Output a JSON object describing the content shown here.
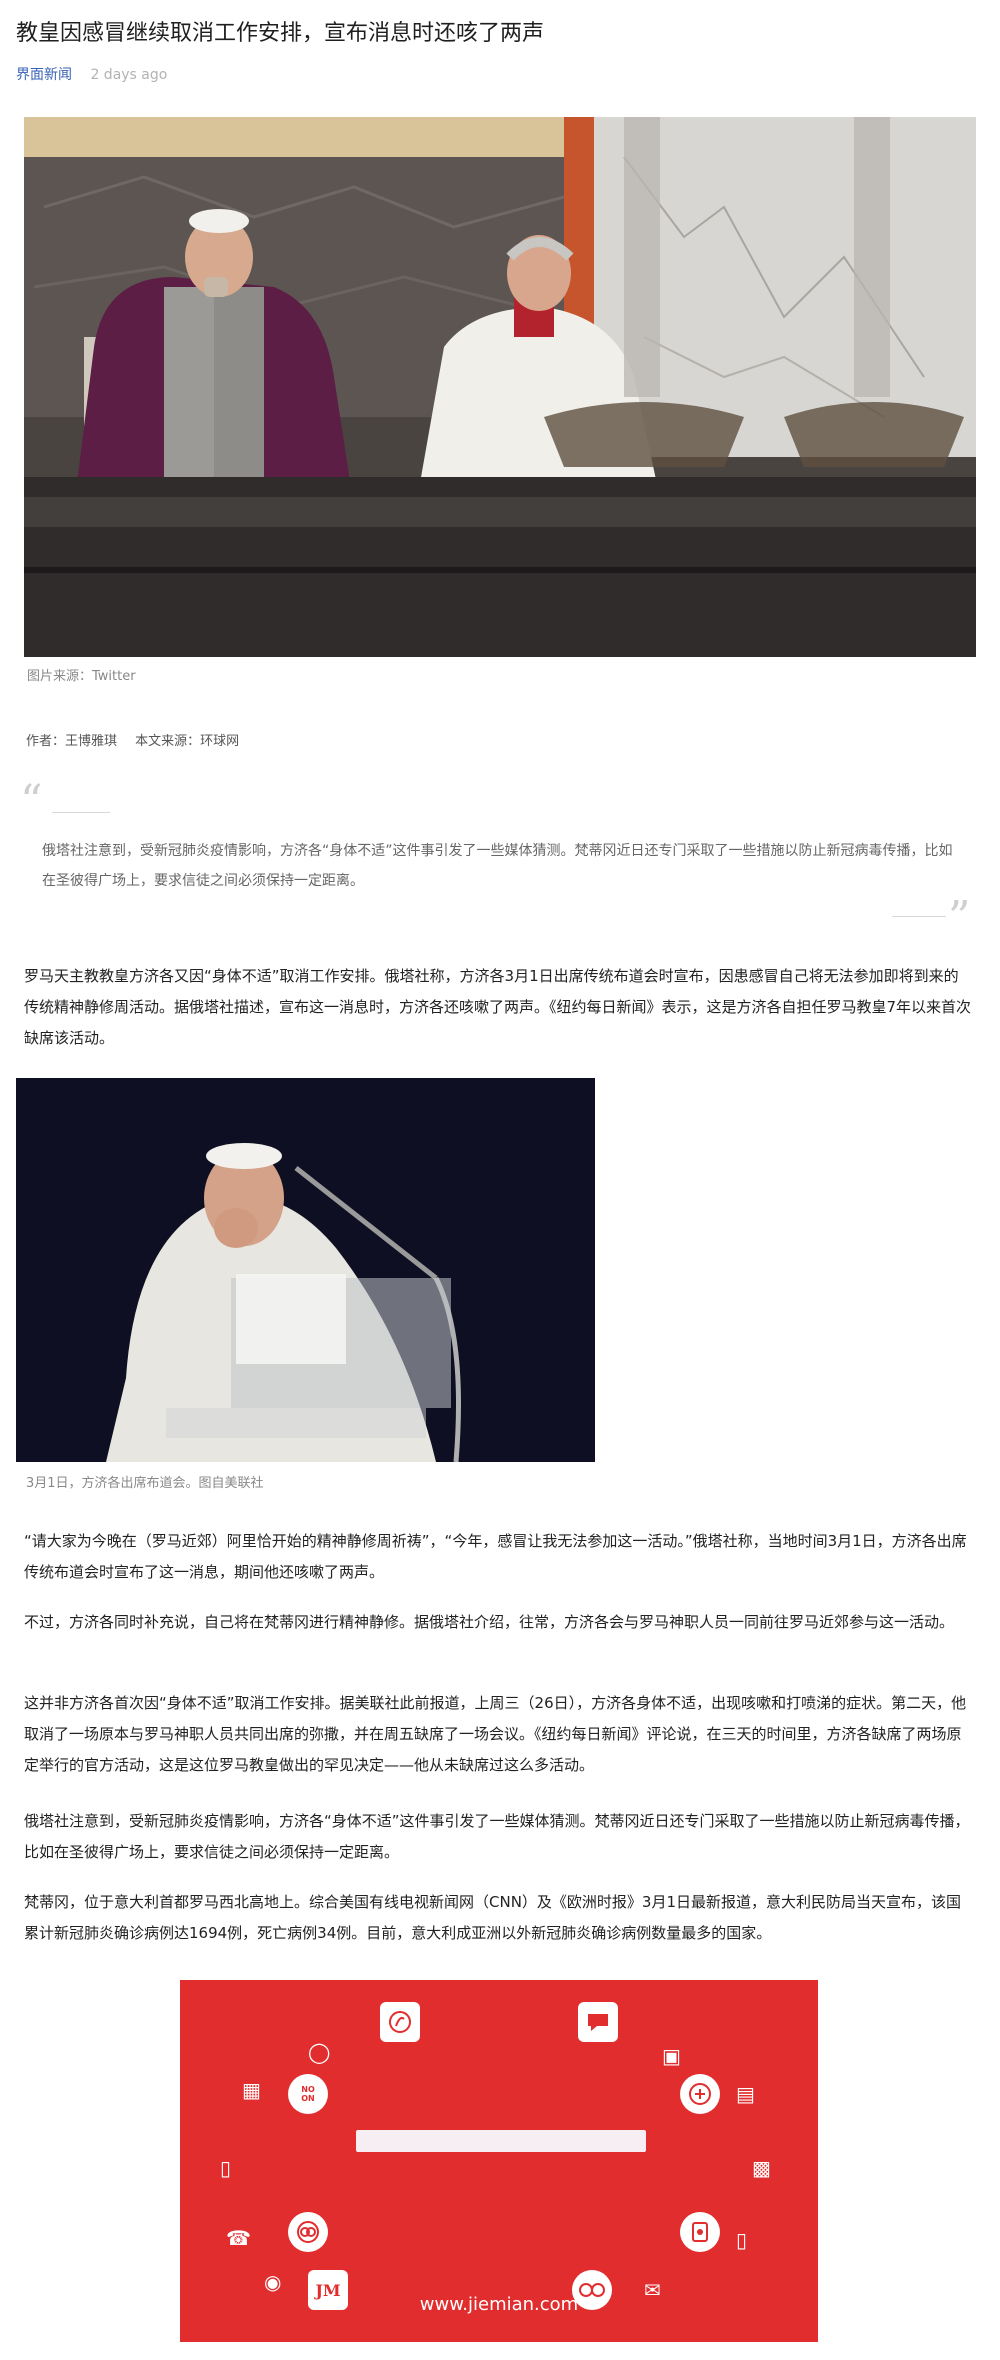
{
  "article": {
    "title": "教皇因感冒继续取消工作安排，宣布消息时还咳了两声",
    "source": "界面新闻",
    "time": "2 days ago"
  },
  "hero_image": {
    "caption": "图片来源：Twitter"
  },
  "byline": {
    "author": "作者：王博雅琪",
    "origin": "本文来源：环球网"
  },
  "summary": "俄塔社注意到，受新冠肺炎疫情影响，方济各“身体不适”这件事引发了一些媒体猜测。梵蒂冈近日还专门采取了一些措施以防止新冠病毒传播，比如在圣彼得广场上，要求信徒之间必须保持一定距离。",
  "paragraphs": [
    "罗马天主教教皇方济各又因“身体不适”取消工作安排。俄塔社称，方济各3月1日出席传统布道会时宣布，因患感冒自己将无法参加即将到来的传统精神静修周活动。据俄塔社描述，宣布这一消息时，方济各还咳嗽了两声。《纽约每日新闻》表示，这是方济各自担任罗马教皇7年以来首次缺席该活动。",
    "“请大家为今晚在（罗马近郊）阿里恰开始的精神静修周祈祷”，“今年，感冒让我无法参加这一活动。”俄塔社称，当地时间3月1日，方济各出席传统布道会时宣布了这一消息，期间他还咳嗽了两声。",
    "不过，方济各同时补充说，自己将在梵蒂冈进行精神静修。据俄塔社介绍，往常，方济各会与罗马神职人员一同前往罗马近郊参与这一活动。",
    "这并非方济各首次因“身体不适”取消工作安排。据美联社此前报道，上周三（26日），方济各身体不适，出现咳嗽和打喷涕的症状。第二天，他取消了一场原本与罗马神职人员共同出席的弥撒，并在周五缺席了一场会议。《纽约每日新闻》评论说，在三天的时间里，方济各缺席了两场原定举行的官方活动，这是这位罗马教皇做出的罕见决定——他从未缺席过这么多活动。",
    "俄塔社注意到，受新冠肺炎疫情影响，方济各“身体不适”这件事引发了一些媒体猜测。梵蒂冈近日还专门采取了一些措施以防止新冠病毒传播，比如在圣彼得广场上，要求信徒之间必须保持一定距离。",
    "梵蒂冈，位于意大利首都罗马西北高地上。综合美国有线电视新闻网（CNN）及《欧洲时报》3月1日最新报道，意大利民防局当天宣布，该国累计新冠肺炎确诊病例达1694例，死亡病例34例。目前，意大利成亚洲以外新冠肺炎确诊病例数量最多的国家。"
  ],
  "photo2": {
    "caption": "3月1日，方济各出席布道会。图自美联社"
  },
  "banner": {
    "url": "www.jiemian.com",
    "tile_no": "NO",
    "tile_on": "ON",
    "tile_jm": "JM",
    "icons": [
      "music-icon",
      "chat-icon",
      "lightbulb-icon",
      "save-icon",
      "building-icon",
      "no-on-icon",
      "coin-icon",
      "clipboard-icon",
      "document-ae-icon",
      "message-icon",
      "phone-icon",
      "loop-icon",
      "tag-icon",
      "mobile-icon",
      "camera-icon",
      "jm-logo-icon",
      "glasses-icon",
      "mail-icon"
    ],
    "color": "#e22d2f"
  }
}
